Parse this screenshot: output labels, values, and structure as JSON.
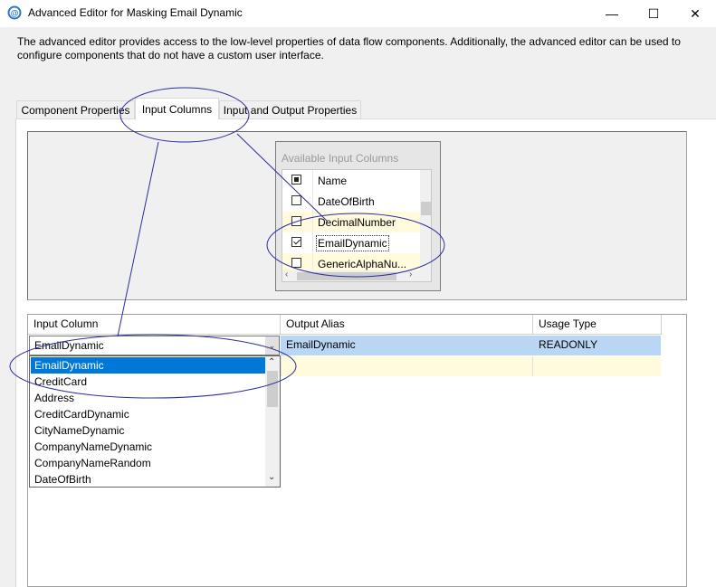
{
  "window": {
    "title": "Advanced Editor for Masking Email Dynamic",
    "minimize_glyph": "—",
    "maximize_glyph": "☐",
    "close_glyph": "✕"
  },
  "description": "The advanced editor provides access to the low-level properties of data flow components. Additionally, the advanced editor can be used to configure components that do not have a custom user interface.",
  "tabs": [
    {
      "label": "Component Properties"
    },
    {
      "label": "Input Columns"
    },
    {
      "label": "Input and Output Properties"
    }
  ],
  "available_input_columns": {
    "title": "Available Input Columns",
    "header": "Name",
    "rows": [
      {
        "name": "DateOfBirth",
        "checked": false
      },
      {
        "name": "DecimalNumber",
        "checked": false
      },
      {
        "name": "EmailDynamic",
        "checked": true
      },
      {
        "name": "GenericAlphaNu...",
        "checked": false
      }
    ]
  },
  "grid": {
    "columns": [
      "Input Column",
      "Output Alias",
      "Usage Type"
    ],
    "rows": [
      {
        "input_column": "EmailDynamic",
        "output_alias": "EmailDynamic",
        "usage_type": "READONLY"
      }
    ]
  },
  "dropdown": {
    "items": [
      "EmailDynamic",
      "CreditCard",
      "Address",
      "CreditCardDynamic",
      "CityNameDynamic",
      "CompanyNameDynamic",
      "CompanyNameRandom",
      "DateOfBirth"
    ],
    "selected": "EmailDynamic"
  },
  "colors": {
    "selection_blue": "#0078d7",
    "row_highlight": "#b9d7f5",
    "new_row": "#fffbdc",
    "annotation": "#2c2ca0"
  },
  "icons": {
    "app": "ssis-component-icon",
    "dropdown": "chevron-down-icon",
    "scroll_up": "chevron-up-icon"
  }
}
